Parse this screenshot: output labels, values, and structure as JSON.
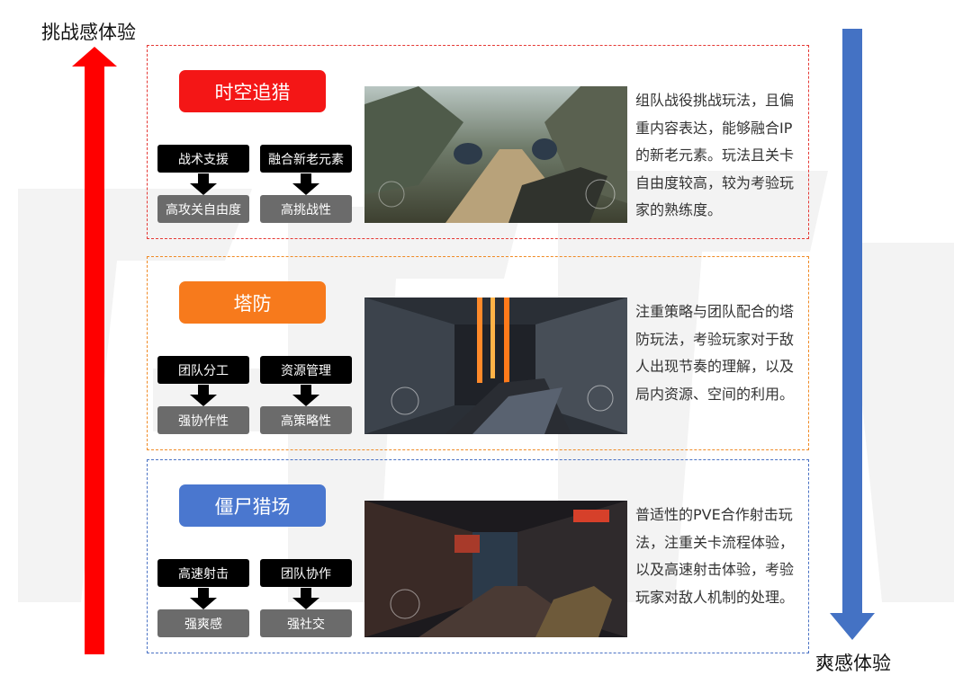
{
  "axis": {
    "top_label": "挑战感体验",
    "bottom_label": "爽感体验",
    "up_arrow_color": "#ff0000",
    "down_arrow_color": "#4472c4"
  },
  "modes": [
    {
      "title": "时空追猎",
      "color": "#f41616",
      "features": [
        "战术支援",
        "融合新老元素"
      ],
      "results": [
        "高攻关自由度",
        "高挑战性"
      ],
      "description": "组队战役挑战玩法，且偏重内容表达，能够融合IP的新老元素。玩法且关卡自由度较高，较为考验玩家的熟练度。"
    },
    {
      "title": "塔防",
      "color": "#f77a1c",
      "features": [
        "团队分工",
        "资源管理"
      ],
      "results": [
        "强协作性",
        "高策略性"
      ],
      "description": "注重策略与团队配合的塔防玩法，考验玩家对于敌人出现节奏的理解，以及局内资源、空间的利用。"
    },
    {
      "title": "僵尸猎场",
      "color": "#4a77cf",
      "features": [
        "高速射击",
        "团队协作"
      ],
      "results": [
        "强爽感",
        "强社交"
      ],
      "description": "普适性的PVE合作射击玩法，注重关卡流程体验，以及高速射击体验，考验玩家对敌人机制的处理。"
    }
  ]
}
